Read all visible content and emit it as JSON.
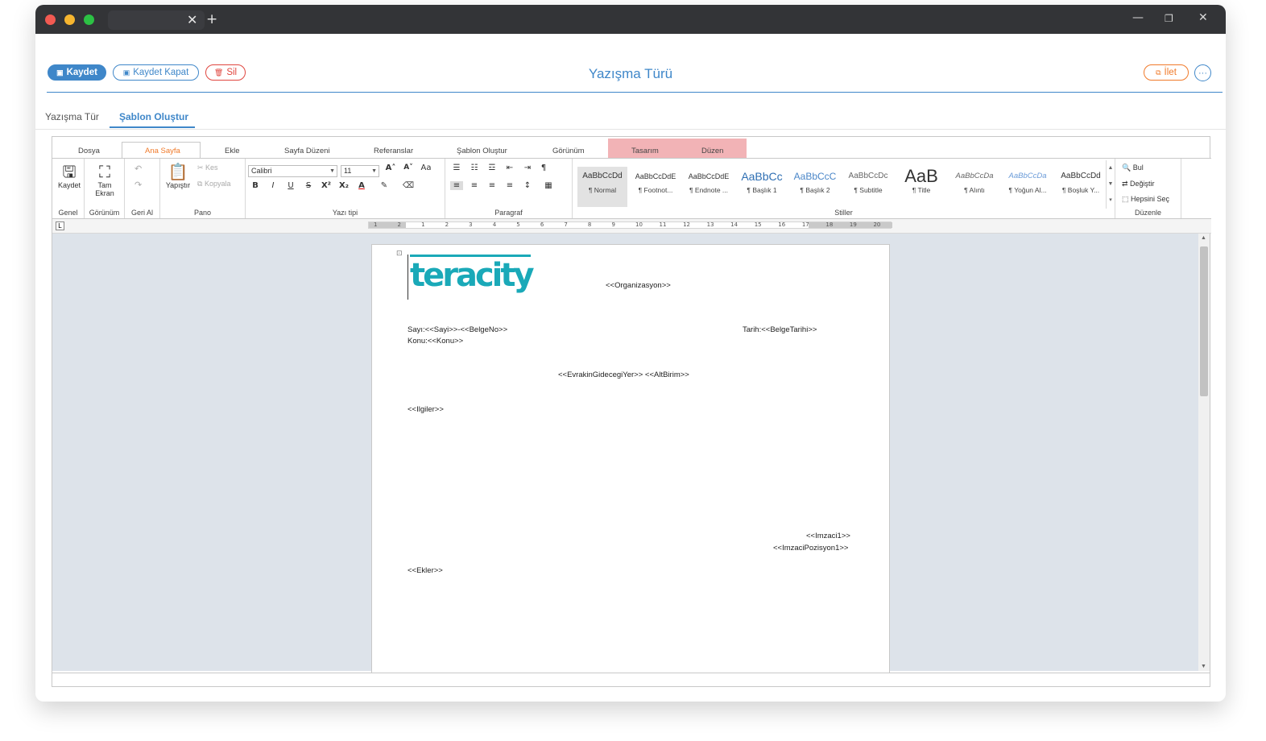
{
  "browser": {
    "close_tab": "✕",
    "new_tab": "+",
    "minimize": "—",
    "restore": "❐",
    "close_window": "✕"
  },
  "toolbar": {
    "save_label": "Kaydet",
    "save_close_label": "Kaydet Kapat",
    "delete_label": "Sil",
    "forward_label": "İlet",
    "more_label": "···"
  },
  "page": {
    "title": "Yazışma Türü",
    "tabs": [
      "Yazışma Tür",
      "Şablon Oluştur"
    ],
    "active_tab": "Şablon Oluştur"
  },
  "ribbon": {
    "tabs": [
      "Dosya",
      "Ana Sayfa",
      "Ekle",
      "Sayfa Düzeni",
      "Referanslar",
      "Şablon Oluştur",
      "Görünüm",
      "Tasarım",
      "Düzen"
    ],
    "active_tab": "Ana Sayfa",
    "groups": {
      "genel": {
        "label": "Genel",
        "save": "Kaydet"
      },
      "gorunum": {
        "label": "Görünüm",
        "fullscreen_1": "Tam",
        "fullscreen_2": "Ekran"
      },
      "gerial": {
        "label": "Geri Al"
      },
      "pano": {
        "label": "Pano",
        "paste": "Yapıştır",
        "cut": "Kes",
        "copy": "Kopyala"
      },
      "yazitipi": {
        "label": "Yazı tipi",
        "font": "Calibri",
        "size": "11"
      },
      "paragraf": {
        "label": "Paragraf"
      },
      "stiller": {
        "label": "Stiller",
        "items": [
          {
            "sample": "AaBbCcDd",
            "name": "¶ Normal"
          },
          {
            "sample": "AaBbCcDdE",
            "name": "¶ Footnot..."
          },
          {
            "sample": "AaBbCcDdE",
            "name": "¶ Endnote ..."
          },
          {
            "sample": "AaBbCc",
            "name": "¶ Başlık 1"
          },
          {
            "sample": "AaBbCcC",
            "name": "¶ Başlık 2"
          },
          {
            "sample": "AaBbCcDc",
            "name": "¶ Subtitle"
          },
          {
            "sample": "AaB",
            "name": "¶ Title"
          },
          {
            "sample": "AaBbCcDa",
            "name": "¶ Alıntı"
          },
          {
            "sample": "AaBbCcDa",
            "name": "¶ Yoğun Al..."
          },
          {
            "sample": "AaBbCcDd",
            "name": "¶ Boşluk Y..."
          }
        ]
      },
      "duzenle": {
        "label": "Düzenle",
        "find": "Bul",
        "replace": "Değiştir",
        "select_all": "Hepsini Seç"
      }
    }
  },
  "ruler": {
    "numbers": [
      "1",
      "2",
      "1",
      "2",
      "3",
      "4",
      "5",
      "6",
      "7",
      "8",
      "9",
      "10",
      "11",
      "12",
      "13",
      "14",
      "15",
      "16",
      "17",
      "18",
      "19",
      "20"
    ]
  },
  "document": {
    "logo_text": "teracity",
    "organization": "<<Organizasyon>>",
    "number": "Sayı:<<Sayi>>-<<BelgeNo>>",
    "subject": "Konu:<<Konu>>",
    "date": "Tarih:<<BelgeTarihi>>",
    "destination": "<<EvrakinGidecegiYer>>  <<AltBirim>>",
    "related": "<<Ilgiler>>",
    "signer": "<<Imzaci1>>",
    "signer_position": "<<ImzaciPozisyon1>>",
    "attachments": "<<Ekler>>"
  },
  "colors": {
    "accent": "#3f87c9",
    "danger": "#e0463f",
    "warning": "#f07a2a",
    "context_tab": "#f2b3b6",
    "logo": "#1aa9b8"
  }
}
